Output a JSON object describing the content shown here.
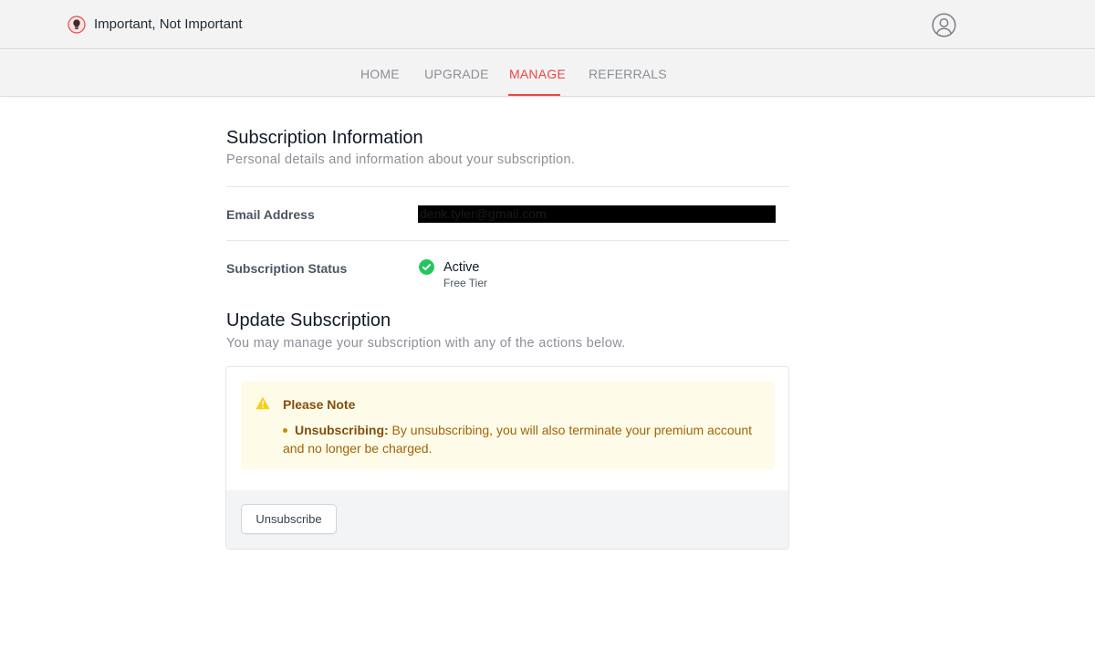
{
  "header": {
    "brand": "Important, Not Important",
    "logo_icon": "lightbulb-logo-icon",
    "account_icon": "user-circle-icon"
  },
  "nav": {
    "tabs": [
      {
        "label": "HOME",
        "active": false
      },
      {
        "label": "UPGRADE",
        "active": false
      },
      {
        "label": "MANAGE",
        "active": true
      },
      {
        "label": "REFERRALS",
        "active": false
      }
    ],
    "active_color": "#ef4444"
  },
  "subscription_info": {
    "title": "Subscription Information",
    "subtitle": "Personal details and information about your subscription.",
    "email_label": "Email Address",
    "email_value": "denk.tyler@gmail.com",
    "status_label": "Subscription Status",
    "status_value": "Active",
    "status_icon": "check-circle-icon",
    "status_color": "#22c55e",
    "tier": "Free Tier"
  },
  "update_subscription": {
    "title": "Update Subscription",
    "subtitle": "You may manage your subscription with any of the actions below.",
    "notice": {
      "icon": "warning-triangle-icon",
      "title": "Please Note",
      "item_bold": "Unsubscribing:",
      "item_text": " By unsubscribing, you will also terminate your premium account and no longer be charged."
    },
    "unsubscribe_label": "Unsubscribe"
  }
}
